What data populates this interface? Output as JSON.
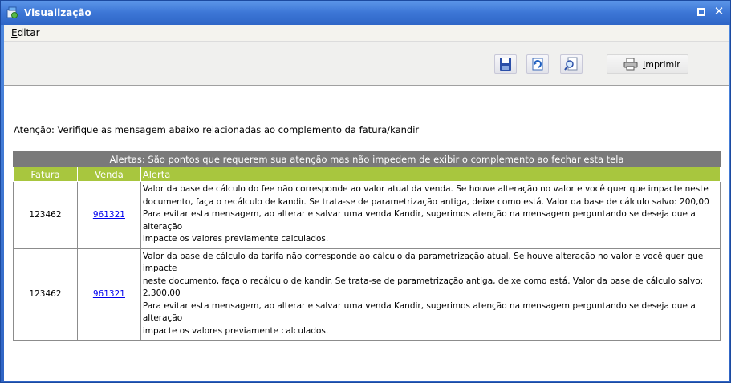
{
  "window": {
    "title": "Visualização"
  },
  "menu": {
    "items": [
      {
        "label": "Editar"
      }
    ]
  },
  "toolbar": {
    "buttons": [
      {
        "icon": "save-icon"
      },
      {
        "icon": "refresh-icon"
      },
      {
        "icon": "zoom-icon"
      }
    ],
    "print_label": "Imprimir"
  },
  "notice": "Atenção: Verifique as mensagem abaixo relacionadas ao complemento da fatura/kandir",
  "alerts": {
    "banner": "Alertas: São pontos que requerem sua atenção mas não impedem de exibir o complemento ao fechar esta tela",
    "columns": [
      "Fatura",
      "Venda",
      "Alerta"
    ],
    "rows": [
      {
        "fatura": "123462",
        "venda": "961321",
        "alerta": [
          "Valor da base de cálculo do fee não corresponde ao valor atual da venda. Se houve alteração no valor e você quer que impacte neste",
          "documento, faça o recálculo de kandir. Se trata-se de parametrização antiga, deixe como está. Valor da base de cálculo salvo: 200,00",
          "Para evitar esta mensagem, ao alterar e salvar uma venda Kandir, sugerimos atenção na mensagem perguntando se deseja que a alteração",
          "impacte os valores previamente calculados."
        ]
      },
      {
        "fatura": "123462",
        "venda": "961321",
        "alerta": [
          "Valor da base de cálculo da tarifa não corresponde ao cálculo da parametrização atual. Se houve alteração no valor e você quer que impacte",
          "neste documento, faça o recálculo de kandir. Se trata-se de parametrização antiga, deixe como está. Valor da base de cálculo salvo: 2.300,00",
          "Para evitar esta mensagem, ao alterar e salvar uma venda Kandir, sugerimos atenção na mensagem perguntando se deseja que a alteração",
          "impacte os valores previamente calculados."
        ]
      }
    ]
  },
  "colors": {
    "titlebar": "#3c76d6",
    "banner": "#7a7a7a",
    "header": "#a8c63e",
    "link": "#0000ee"
  }
}
